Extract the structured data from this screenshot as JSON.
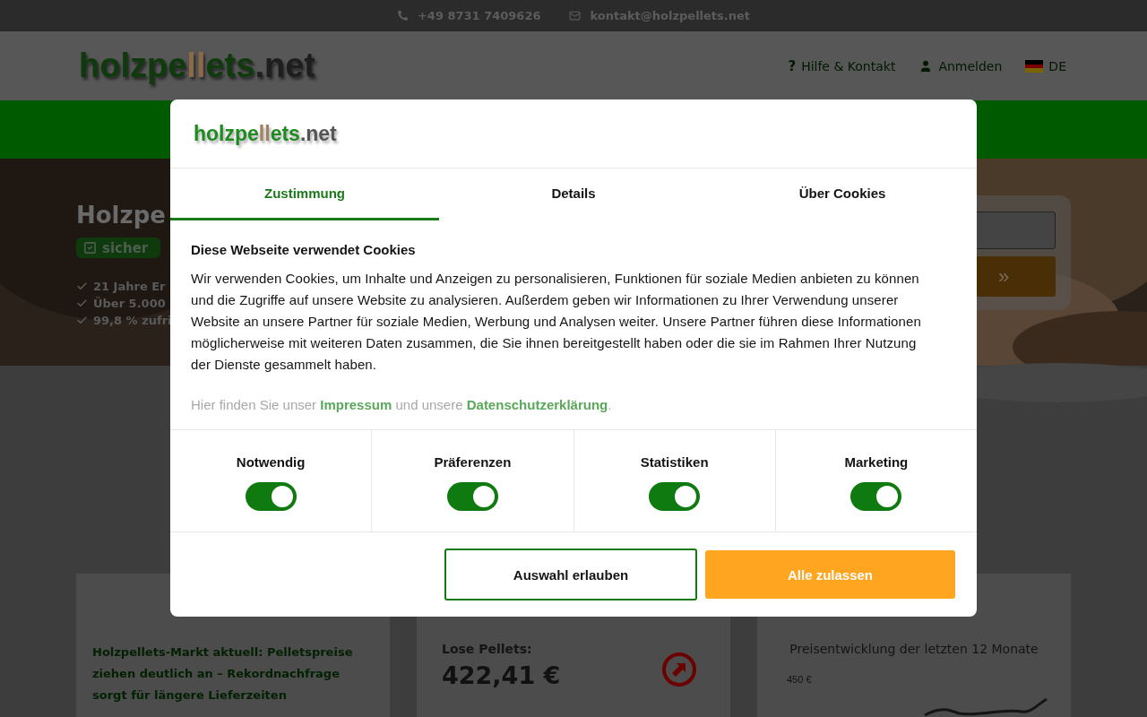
{
  "top_bar": {
    "phone": "+49 8731 7409626",
    "email": "kontakt@holzpellets.net"
  },
  "header": {
    "logo": [
      {
        "text": "holzpe",
        "color": "#0e3a0e"
      },
      {
        "text": "ll",
        "color": "#8a6a48"
      },
      {
        "text": "ets",
        "color": "#0e3a0e"
      },
      {
        "text": ".net",
        "color": "#1e1e1e"
      }
    ],
    "help_icon": "?",
    "help": "Hilfe & Kontakt",
    "login": "Anmelden",
    "language": "DE"
  },
  "hero": {
    "title": "Holzpe",
    "badge": "sicher",
    "checks": [
      "21 Jahre Er",
      "Über 5.000",
      "99,8 % zufri"
    ],
    "search_button": "»"
  },
  "cards": [
    {
      "kind": "news",
      "title": "Holzpellets-Markt aktuell: Pelletspreise ziehen deutlich an – Rekordnachfrage sorgt für längere Lieferzeiten"
    },
    {
      "kind": "price",
      "label": "Lose Pellets:",
      "price": "422,41 €"
    },
    {
      "kind": "chart",
      "title": "Preisentwicklung der letzten 12 Monate",
      "tick": "450 €"
    }
  ],
  "cookie_dialog": {
    "logo": [
      {
        "text": "holzpe",
        "color": "#1f8a1f"
      },
      {
        "text": "ll",
        "color": "#a08060"
      },
      {
        "text": "ets",
        "color": "#1f8a1f"
      },
      {
        "text": ".net",
        "color": "#555555"
      }
    ],
    "tabs": [
      {
        "label": "Zustimmung",
        "selected": true
      },
      {
        "label": "Details",
        "selected": false
      },
      {
        "label": "Über Cookies",
        "selected": false
      }
    ],
    "heading": "Diese Webseite verwendet Cookies",
    "text": "Wir verwenden Cookies, um Inhalte und Anzeigen zu personalisieren, Funktionen für soziale Medien anbieten zu können und die Zugriffe auf unsere Website zu analysieren. Außerdem geben wir Informationen zu Ihrer Verwendung unserer Website an unsere Partner für soziale Medien, Werbung und Analysen weiter. Unsere Partner führen diese Informationen möglicherweise mit weiteren Daten zusammen, die Sie ihnen bereitgestellt haben oder die sie im Rahmen Ihrer Nutzung der Dienste gesammelt haben.",
    "legal": {
      "before": "Hier finden Sie unser",
      "link1": "Impressum",
      "middle": "und unsere",
      "link2": "Datenschutzerklärung",
      "after": "."
    },
    "categories": [
      {
        "label": "Notwendig",
        "on": true
      },
      {
        "label": "Präferenzen",
        "on": true
      },
      {
        "label": "Statistiken",
        "on": true
      },
      {
        "label": "Marketing",
        "on": true
      }
    ],
    "buttons": [
      {
        "label": "Auswahl erlauben",
        "kind": "outline"
      },
      {
        "label": "Alle zulassen",
        "kind": "primary"
      }
    ]
  }
}
